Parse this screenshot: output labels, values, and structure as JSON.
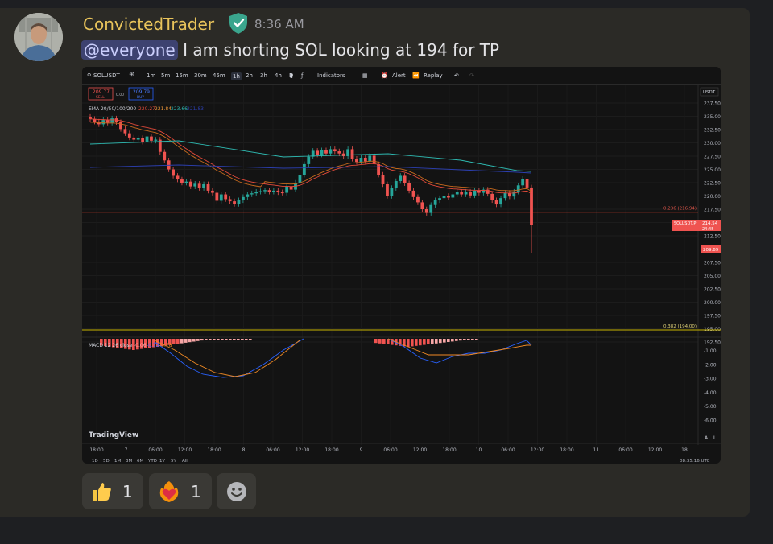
{
  "message": {
    "author": "ConvictedTrader",
    "timestamp": "8:36 AM",
    "mention": "@everyone",
    "text": " I am shorting SOL looking at 194 for TP",
    "colors": {
      "author": "#e9c45b",
      "badge": "#3aa58d",
      "mention_bg": "#3d4270"
    }
  },
  "chart_toolbar": {
    "symbol": "SOLUSDT",
    "timeframes": [
      "1m",
      "5m",
      "15m",
      "30m",
      "45m",
      "1h",
      "2h",
      "3h",
      "4h",
      "D"
    ],
    "active_timeframe": "1h",
    "indicators_label": "Indicators",
    "alert_label": "Alert",
    "replay_label": "Replay"
  },
  "chart_overlay": {
    "sell_price": "209.77",
    "sell_label": "SELL",
    "spread": "0.00",
    "buy_price": "209.79",
    "buy_label": "BUY",
    "ema_label": "EMA 20/50/100/200",
    "ema_values": [
      "220.27",
      "221.84",
      "223.66",
      "221.83"
    ],
    "fib_236_label": "0.236 (216.94)",
    "fib_382_label": "0.382 (194.00)",
    "current_price_tag": "SOLUSDT.P",
    "current_price": "214.54",
    "countdown": "24:45",
    "low_price": "209.69",
    "macd_label": "MACD 12 26 close",
    "macd_values": [
      "-0.06",
      "-0.72",
      "-0.78"
    ],
    "currency": "USDT",
    "brand": "TradingView",
    "bottom_time": "08:35:16 UTC",
    "bottom_icons": [
      "A",
      "L"
    ],
    "ranges": [
      "1D",
      "5D",
      "1M",
      "3M",
      "6M",
      "YTD",
      "1Y",
      "5Y",
      "All"
    ]
  },
  "chart_data": {
    "type": "candlestick",
    "y_ticks": [
      "237.50",
      "235.00",
      "232.50",
      "230.00",
      "227.50",
      "225.00",
      "222.50",
      "220.00",
      "217.50",
      "215.00",
      "212.50",
      "210.00",
      "207.50",
      "205.00",
      "202.50",
      "200.00",
      "197.50",
      "195.00",
      "192.50"
    ],
    "ylim": [
      192.5,
      237.5
    ],
    "macd_ticks": [
      "-1.00",
      "-2.00",
      "-3.00",
      "-4.00",
      "-5.00",
      "-6.00"
    ],
    "x_labels": [
      "18:00",
      "7",
      "06:00",
      "12:00",
      "18:00",
      "8",
      "06:00",
      "12:00",
      "18:00",
      "9",
      "06:00",
      "12:00",
      "18:00",
      "10",
      "06:00",
      "12:00",
      "18:00",
      "11",
      "06:00",
      "12:00",
      "18"
    ],
    "fib_levels": [
      216.94,
      194.0
    ],
    "close_series": [
      234.5,
      234.0,
      233.5,
      234.3,
      233.8,
      234.6,
      233.9,
      232.6,
      231.8,
      231.0,
      230.6,
      230.9,
      230.2,
      231.2,
      230.4,
      230.6,
      228.3,
      226.7,
      225.0,
      223.8,
      223.1,
      222.5,
      222.7,
      221.8,
      222.3,
      221.5,
      222.2,
      221.0,
      220.6,
      219.1,
      220.3,
      219.4,
      219.0,
      218.5,
      219.2,
      219.8,
      220.3,
      220.5,
      220.8,
      220.9,
      221.1,
      220.8,
      221.0,
      220.7,
      220.6,
      221.8,
      221.2,
      222.5,
      224.0,
      226.0,
      227.4,
      228.5,
      227.8,
      228.6,
      228.0,
      228.8,
      228.4,
      228.0,
      227.5,
      228.8,
      227.0,
      226.4,
      227.2,
      226.5,
      227.6,
      226.0,
      224.0,
      222.2,
      220.0,
      221.5,
      222.8,
      223.8,
      222.4,
      221.0,
      219.8,
      218.8,
      217.5,
      216.8,
      218.3,
      219.2,
      219.6,
      220.0,
      219.7,
      220.3,
      220.8,
      220.3,
      220.8,
      220.1,
      221.0,
      220.6,
      221.2,
      220.4,
      219.2,
      218.4,
      219.6,
      220.6,
      219.9,
      220.8,
      222.0,
      223.2,
      221.6,
      214.54
    ]
  },
  "reactions": [
    {
      "emoji_name": "thumbs-up",
      "count": "1"
    },
    {
      "emoji_name": "fire-heart",
      "count": "1"
    }
  ],
  "add_reaction_icon": "smiley-add-reaction"
}
